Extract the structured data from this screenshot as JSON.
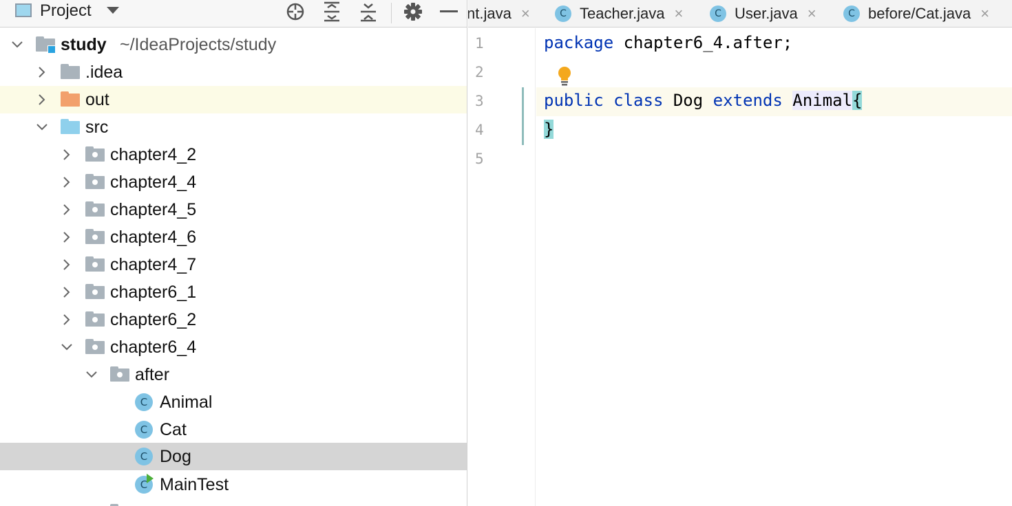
{
  "project_pane": {
    "title": "Project",
    "tree": [
      {
        "label": "study",
        "path": "~/IdeaProjects/study"
      },
      {
        "label": ".idea"
      },
      {
        "label": "out"
      },
      {
        "label": "src"
      },
      {
        "label": "chapter4_2"
      },
      {
        "label": "chapter4_4"
      },
      {
        "label": "chapter4_5"
      },
      {
        "label": "chapter4_6"
      },
      {
        "label": "chapter4_7"
      },
      {
        "label": "chapter6_1"
      },
      {
        "label": "chapter6_2"
      },
      {
        "label": "chapter6_4"
      },
      {
        "label": "after"
      },
      {
        "label": "Animal"
      },
      {
        "label": "Cat"
      },
      {
        "label": "Dog"
      },
      {
        "label": "MainTest"
      }
    ],
    "selected_item": "Dog"
  },
  "editor": {
    "tabs": [
      {
        "label": "nt.java",
        "close": "×"
      },
      {
        "label": "Teacher.java",
        "close": "×"
      },
      {
        "label": "User.java",
        "close": "×"
      },
      {
        "label": "before/Cat.java",
        "close": "×"
      }
    ],
    "class_icon_letter": "C",
    "line_numbers": [
      "1",
      "2",
      "3",
      "4",
      "5"
    ],
    "code": {
      "l1_kw": "package",
      "l1_rest": " chapter6_4.after;",
      "l3_kw1": "public",
      "l3_kw2": "class",
      "l3_name": "Dog",
      "l3_kw3": "extends",
      "l3_parent": "Animal",
      "l3_brace": "{",
      "l4_brace": "}"
    }
  },
  "colors": {
    "keyword": "#0033b3",
    "class_icon": "#7fc3e4",
    "folder_gray": "#a9b3bb",
    "folder_orange": "#f2a06c",
    "folder_blue": "#8fd0ec",
    "selection": "#d5d5d5",
    "brace_match": "#93d9d9"
  },
  "icons": {
    "header": [
      "locate-icon",
      "expand-all-icon",
      "collapse-all-icon",
      "gear-icon",
      "hide-icon"
    ],
    "gutter": [
      "lightbulb-icon"
    ]
  }
}
